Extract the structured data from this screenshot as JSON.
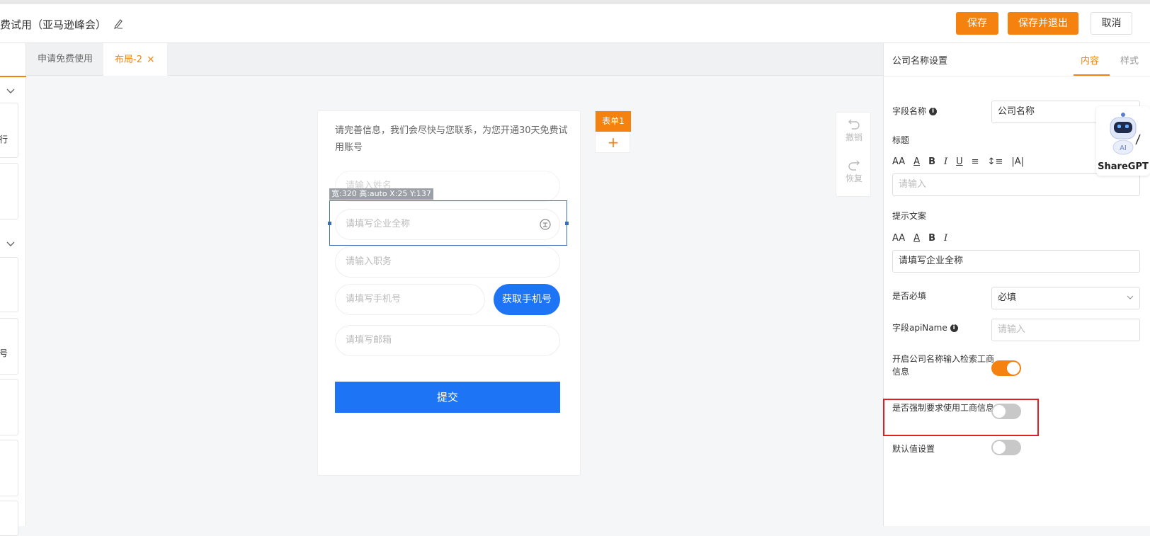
{
  "header": {
    "title": "费试用（亚马逊峰会）",
    "save_label": "保存",
    "save_exit_label": "保存并退出",
    "cancel_label": "取消"
  },
  "left_panel": {
    "card_texts": [
      "行",
      "号"
    ]
  },
  "tabs": [
    {
      "label": "申请免费使用"
    },
    {
      "label": "布局-2",
      "close": "×"
    }
  ],
  "form": {
    "intro": "请完善信息，我们会尽快与您联系，为您开通30天免费试用账号",
    "name_placeholder": "请输入姓名",
    "company_placeholder": "请填写企业全称",
    "position_placeholder": "请输入职务",
    "phone_placeholder": "请填写手机号",
    "get_phone_label": "获取手机号",
    "email_placeholder": "请填写邮箱",
    "submit_label": "提交",
    "selection_label": "宽:320 高:auto X:25 Y:137"
  },
  "form_tag": {
    "label": "表单1",
    "add": "+"
  },
  "history": {
    "undo_label": "撤销",
    "redo_label": "恢复"
  },
  "settings": {
    "panel_title": "公司名称设置",
    "tab_content": "内容",
    "tab_style": "样式",
    "field_name_label": "字段名称",
    "field_name_value": "公司名称",
    "title_label": "标题",
    "title_placeholder": "请输入",
    "hint_label": "提示文案",
    "hint_value": "请填写企业全称",
    "required_label": "是否必填",
    "required_value": "必填",
    "api_name_label": "字段apiName",
    "api_name_placeholder": "请输入",
    "business_search_label": "开启公司名称输入检索工商信息",
    "business_search_on": true,
    "force_business_label": "是否强制要求使用工商信息",
    "force_business_on": false,
    "default_value_label": "默认值设置",
    "default_value_on": false,
    "toolbar_full": [
      "AA",
      "A",
      "B",
      "I",
      "U",
      "≡",
      "↕≡",
      "|A|"
    ],
    "toolbar_short": [
      "AA",
      "A",
      "B",
      "I"
    ]
  },
  "sharegpt": {
    "label": "ShareGPT",
    "badge": "AI"
  },
  "colors": {
    "accent": "#f5820f",
    "primary_blue": "#1d74f5",
    "highlight_red": "#e02020"
  }
}
